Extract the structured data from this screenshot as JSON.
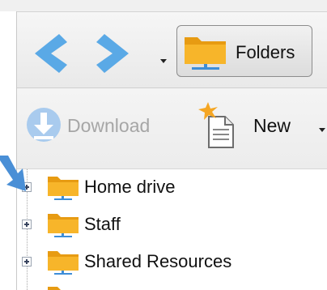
{
  "toolbar": {
    "folders_label": "Folders",
    "download_label": "Download",
    "new_label": "New"
  },
  "tree": {
    "items": [
      {
        "label": "Home drive"
      },
      {
        "label": "Staff"
      },
      {
        "label": "Shared Resources"
      }
    ]
  },
  "colors": {
    "nav_arrow": "#5aa9e6",
    "folder": "#f7b52a",
    "disabled_text": "#a6a6a6",
    "pointer_arrow": "#4a8fd6"
  }
}
